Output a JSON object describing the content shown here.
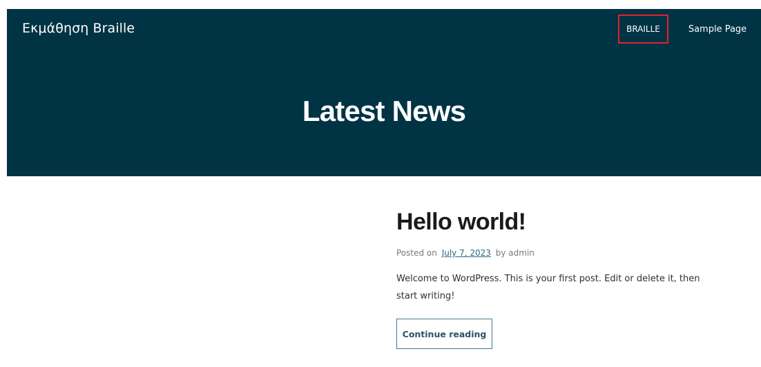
{
  "colors": {
    "header_background": "#003344",
    "highlight_border": "#e3212b",
    "link": "#2c6a7f"
  },
  "site": {
    "title": "Εκμάθηση Braille"
  },
  "nav": {
    "items": [
      {
        "label": "BRAILLE",
        "highlighted": true
      },
      {
        "label": "Sample Page",
        "highlighted": false
      }
    ]
  },
  "hero": {
    "title": "Latest News"
  },
  "post": {
    "title": "Hello world!",
    "meta_prefix": "Posted on",
    "date": "July 7, 2023",
    "meta_by": "by",
    "author": "admin",
    "excerpt": "Welcome to WordPress. This is your first post. Edit or delete it, then start writing!",
    "continue_label": "Continue reading"
  }
}
